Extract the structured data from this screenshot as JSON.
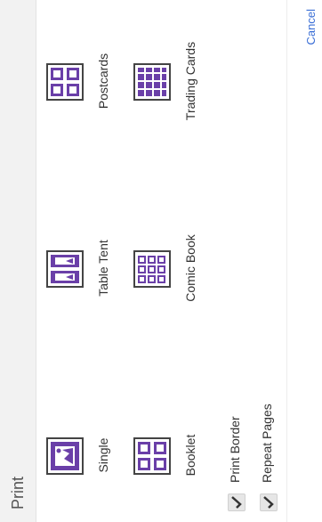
{
  "dialog": {
    "title": "Print",
    "cancel_label": "Cancel"
  },
  "layouts": [
    {
      "label": "Single",
      "icon": "single-page-icon"
    },
    {
      "label": "Table Tent",
      "icon": "table-tent-icon"
    },
    {
      "label": "Postcards",
      "icon": "postcards-icon"
    },
    {
      "label": "Booklet",
      "icon": "booklet-icon"
    },
    {
      "label": "Comic Book",
      "icon": "comic-book-icon"
    },
    {
      "label": "Trading Cards",
      "icon": "trading-cards-icon"
    }
  ],
  "options": [
    {
      "label": "Print Border",
      "checked": true
    },
    {
      "label": "Repeat Pages",
      "checked": true
    }
  ],
  "colors": {
    "accent": "#6a3fa8",
    "frame": "#444444",
    "cancel": "#3b6fd6"
  }
}
